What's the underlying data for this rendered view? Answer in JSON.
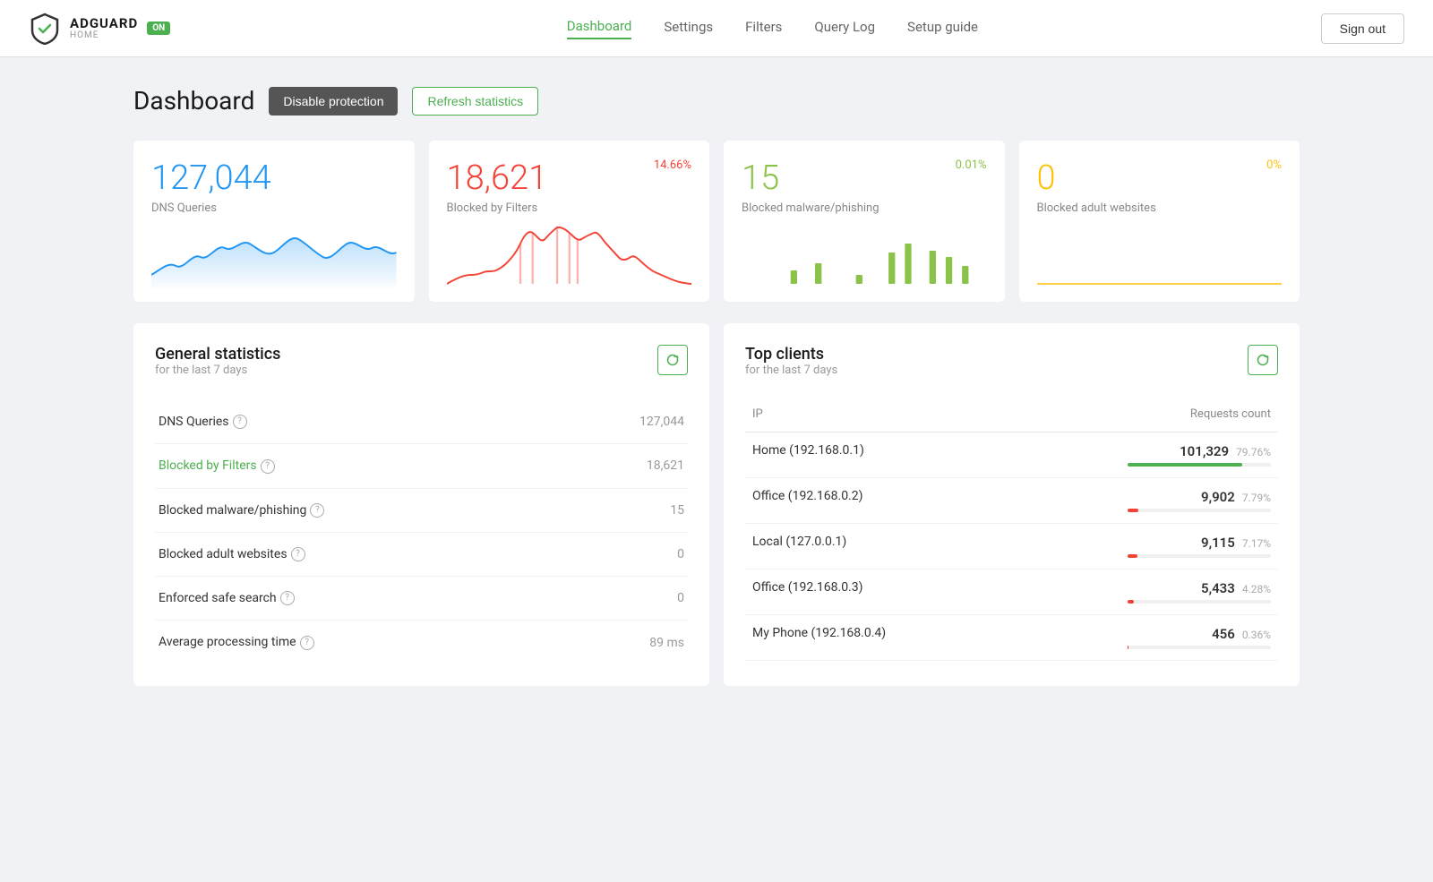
{
  "brand": {
    "name": "ADGUARD",
    "sub": "HOME",
    "badge": "ON"
  },
  "nav": {
    "links": [
      {
        "label": "Dashboard",
        "active": true
      },
      {
        "label": "Settings",
        "active": false
      },
      {
        "label": "Filters",
        "active": false
      },
      {
        "label": "Query Log",
        "active": false
      },
      {
        "label": "Setup guide",
        "active": false
      }
    ],
    "signout": "Sign out"
  },
  "page": {
    "title": "Dashboard",
    "disable_label": "Disable protection",
    "refresh_label": "Refresh statistics"
  },
  "stat_cards": [
    {
      "number": "127,044",
      "label": "DNS Queries",
      "percent": "",
      "color": "blue",
      "percent_color": "blue",
      "chart_color": "#2196f3",
      "chart_fill": "rgba(33,150,243,0.15)"
    },
    {
      "number": "18,621",
      "label": "Blocked by Filters",
      "percent": "14.66%",
      "color": "red",
      "percent_color": "red",
      "chart_color": "#f44336",
      "chart_fill": "rgba(244,67,54,0.1)"
    },
    {
      "number": "15",
      "label": "Blocked malware/phishing",
      "percent": "0.01%",
      "color": "green",
      "percent_color": "green",
      "chart_color": "#8bc34a",
      "chart_fill": "rgba(139,195,74,0.15)"
    },
    {
      "number": "0",
      "label": "Blocked adult websites",
      "percent": "0%",
      "color": "orange",
      "percent_color": "orange",
      "chart_color": "#ffc107",
      "chart_fill": "rgba(255,193,7,0.15)"
    }
  ],
  "general_stats": {
    "title": "General statistics",
    "subtitle": "for the last 7 days",
    "rows": [
      {
        "label": "DNS Queries",
        "value": "127,044",
        "link": false
      },
      {
        "label": "Blocked by Filters",
        "value": "18,621",
        "link": true
      },
      {
        "label": "Blocked malware/phishing",
        "value": "15",
        "link": false
      },
      {
        "label": "Blocked adult websites",
        "value": "0",
        "link": false
      },
      {
        "label": "Enforced safe search",
        "value": "0",
        "link": false
      },
      {
        "label": "Average processing time",
        "value": "89 ms",
        "link": false
      }
    ]
  },
  "top_clients": {
    "title": "Top clients",
    "subtitle": "for the last 7 days",
    "col_ip": "IP",
    "col_requests": "Requests count",
    "rows": [
      {
        "name": "Home (192.168.0.1)",
        "count": "101,329",
        "pct": "79.76%",
        "bar_pct": 79.76,
        "bar_color": "green"
      },
      {
        "name": "Office (192.168.0.2)",
        "count": "9,902",
        "pct": "7.79%",
        "bar_pct": 7.79,
        "bar_color": "red"
      },
      {
        "name": "Local (127.0.0.1)",
        "count": "9,115",
        "pct": "7.17%",
        "bar_pct": 7.17,
        "bar_color": "red"
      },
      {
        "name": "Office (192.168.0.3)",
        "count": "5,433",
        "pct": "4.28%",
        "bar_pct": 4.28,
        "bar_color": "red"
      },
      {
        "name": "My Phone (192.168.0.4)",
        "count": "456",
        "pct": "0.36%",
        "bar_pct": 0.36,
        "bar_color": "red"
      }
    ]
  }
}
